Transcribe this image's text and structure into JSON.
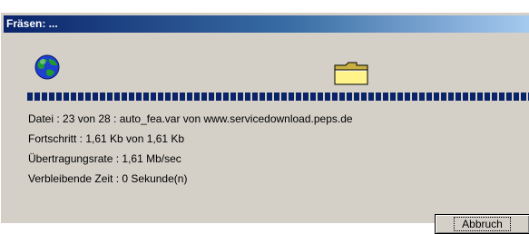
{
  "window": {
    "title": "Fräsen: ..."
  },
  "icons": {
    "source": "globe-icon",
    "target": "folder-icon"
  },
  "progress": {
    "fraction": 1.0
  },
  "status": {
    "file_line": "Datei : 23 von 28 : auto_fea.var von www.servicedownload.peps.de",
    "progress_line": "Fortschritt : 1,61 Kb von 1,61 Kb",
    "rate_line": "Übertragungsrate : 1,61 Mb/sec",
    "remaining_line": "Verbleibende Zeit : 0 Sekunde(n)"
  },
  "buttons": {
    "cancel_label": "Abbruch"
  },
  "colors": {
    "titlebar_start": "#0a246a",
    "titlebar_end": "#a6caf0",
    "progress": "#0a246a",
    "dialog_bg": "#d4d0c8"
  }
}
